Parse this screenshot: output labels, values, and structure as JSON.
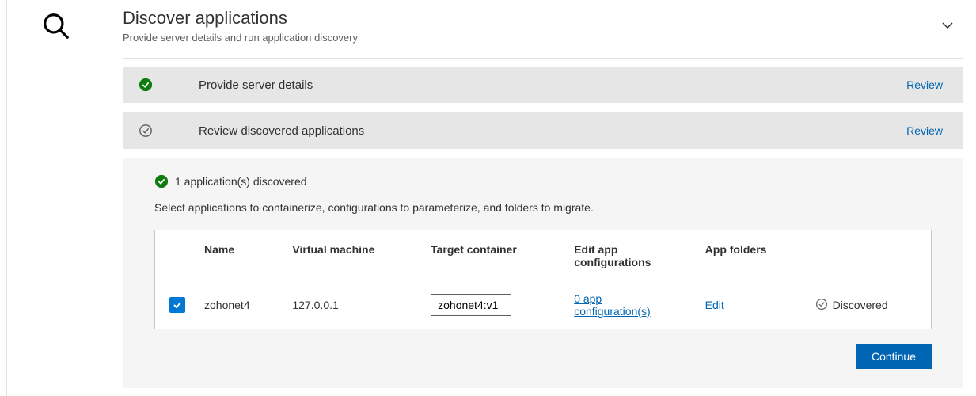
{
  "page": {
    "title": "Discover applications",
    "subtitle": "Provide server details and run application discovery"
  },
  "sections": {
    "step1": {
      "title": "Provide server details",
      "action": "Review"
    },
    "step2": {
      "title": "Review discovered applications",
      "action": "Review"
    }
  },
  "discovered": {
    "summary": "1 application(s) discovered",
    "instruction": "Select applications to containerize, configurations to parameterize, and folders to migrate."
  },
  "table": {
    "headers": {
      "name": "Name",
      "vm": "Virtual machine",
      "target": "Target container",
      "editapp_line1": "Edit app",
      "editapp_line2": "configurations",
      "folders": "App folders"
    },
    "rows": [
      {
        "checked": true,
        "name": "zohonet4",
        "vm": "127.0.0.1",
        "target": "zohonet4:v1",
        "config_line1": "0 app",
        "config_line2": "configuration(s)",
        "folders": "Edit",
        "status": "Discovered"
      }
    ]
  },
  "buttons": {
    "continue": "Continue"
  }
}
